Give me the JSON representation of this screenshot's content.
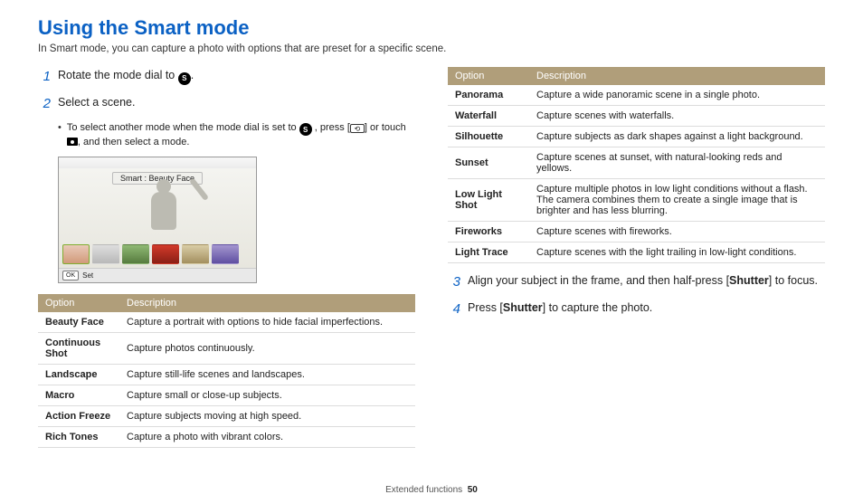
{
  "title": "Using the Smart mode",
  "subtitle": "In Smart mode, you can capture a photo with options that are preset for a specific scene.",
  "steps": {
    "s1": "Rotate the mode dial to ",
    "s1_tail": ".",
    "s2": "Select a scene.",
    "s2_bullet_a": "To select another mode when the mode dial is set to ",
    "s2_bullet_b": ", press [",
    "s2_bullet_c": "] or touch ",
    "s2_bullet_d": ", and then select a mode.",
    "s3_a": "Align your subject in the frame, and then half-press [",
    "s3_b": "Shutter",
    "s3_c": "] to focus.",
    "s4_a": "Press [",
    "s4_b": "Shutter",
    "s4_c": "] to capture the photo."
  },
  "preview": {
    "label": "Smart : Beauty Face",
    "ok": "OK",
    "set": "Set"
  },
  "table_headers": {
    "option": "Option",
    "description": "Description"
  },
  "table_left": [
    {
      "opt": "Beauty Face",
      "desc": "Capture a portrait with options to hide facial imperfections."
    },
    {
      "opt": "Continuous Shot",
      "desc": "Capture photos continuously."
    },
    {
      "opt": "Landscape",
      "desc": "Capture still-life scenes and landscapes."
    },
    {
      "opt": "Macro",
      "desc": "Capture small or close-up subjects."
    },
    {
      "opt": "Action Freeze",
      "desc": "Capture subjects moving at high speed."
    },
    {
      "opt": "Rich Tones",
      "desc": "Capture a photo with vibrant colors."
    }
  ],
  "table_right": [
    {
      "opt": "Panorama",
      "desc": "Capture a wide panoramic scene in a single photo."
    },
    {
      "opt": "Waterfall",
      "desc": "Capture scenes with waterfalls."
    },
    {
      "opt": "Silhouette",
      "desc": "Capture subjects as dark shapes against a light background."
    },
    {
      "opt": "Sunset",
      "desc": "Capture scenes at sunset, with natural-looking reds and yellows."
    },
    {
      "opt": "Low Light Shot",
      "desc": "Capture multiple photos in low light conditions without a flash. The camera combines them to create a single image that is brighter and has less blurring."
    },
    {
      "opt": "Fireworks",
      "desc": "Capture scenes with fireworks."
    },
    {
      "opt": "Light Trace",
      "desc": "Capture scenes with the light trailing in low-light conditions."
    }
  ],
  "footer": {
    "section": "Extended functions",
    "page": "50"
  },
  "icon_letter": "S"
}
